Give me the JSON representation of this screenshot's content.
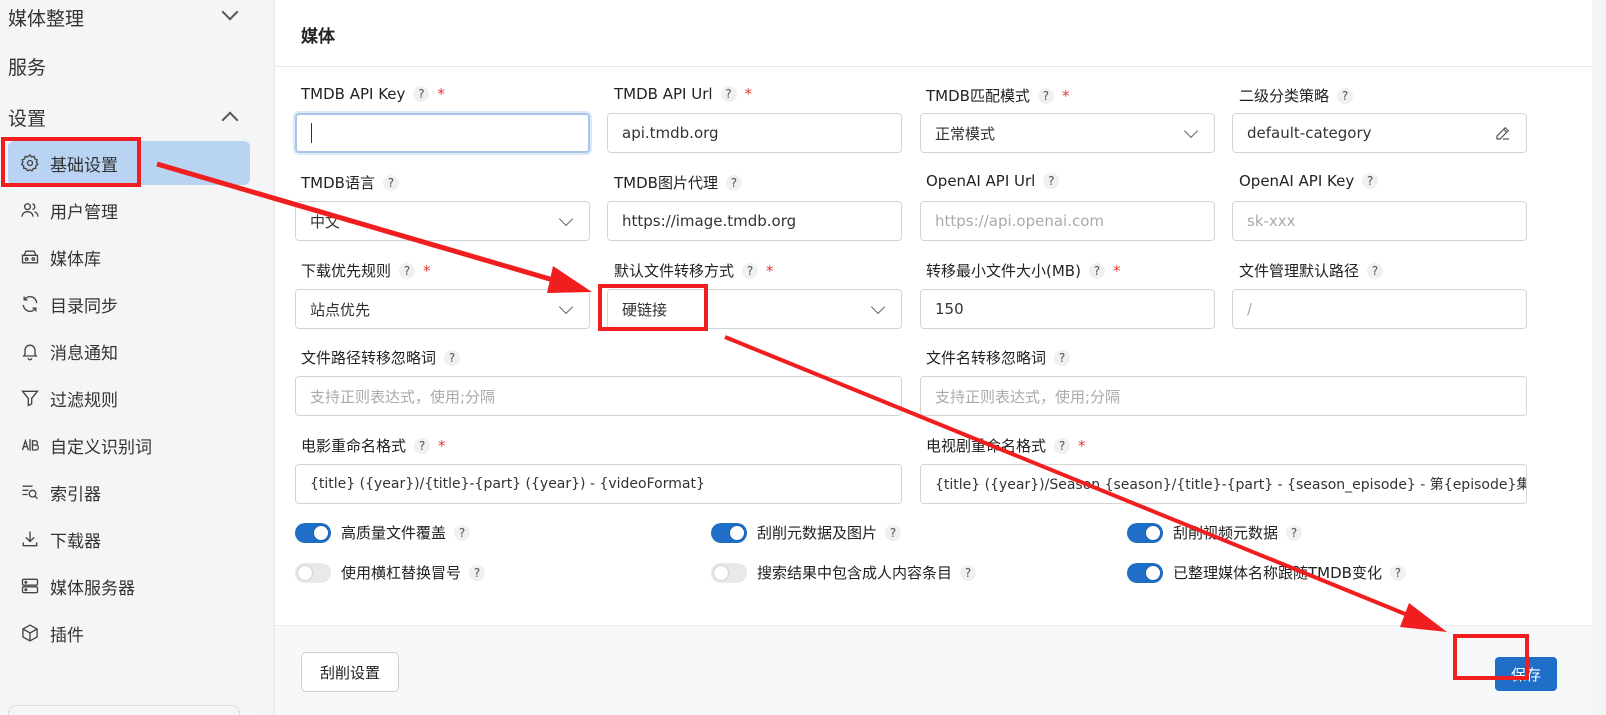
{
  "sidebar": {
    "groups": [
      {
        "label": "媒体整理",
        "expanded": false
      },
      {
        "label": "服务"
      },
      {
        "label": "设置",
        "expanded": true
      }
    ],
    "items": [
      {
        "label": "基础设置",
        "icon": "gear-icon",
        "active": true
      },
      {
        "label": "用户管理",
        "icon": "users-icon"
      },
      {
        "label": "媒体库",
        "icon": "media-library-icon"
      },
      {
        "label": "目录同步",
        "icon": "sync-icon"
      },
      {
        "label": "消息通知",
        "icon": "bell-icon"
      },
      {
        "label": "过滤规则",
        "icon": "filter-icon"
      },
      {
        "label": "自定义识别词",
        "icon": "ab-icon"
      },
      {
        "label": "索引器",
        "icon": "indexer-icon"
      },
      {
        "label": "下载器",
        "icon": "download-icon"
      },
      {
        "label": "媒体服务器",
        "icon": "server-icon"
      },
      {
        "label": "插件",
        "icon": "plugin-icon"
      }
    ]
  },
  "card": {
    "title": "媒体",
    "help_mark": "?",
    "required_mark": "*",
    "fields": {
      "tmdb_api_key": {
        "label": "TMDB API Key",
        "value": ""
      },
      "tmdb_api_url": {
        "label": "TMDB API Url",
        "value": "api.tmdb.org"
      },
      "tmdb_match_mode": {
        "label": "TMDB匹配模式",
        "value": "正常模式"
      },
      "secondary_category": {
        "label": "二级分类策略",
        "value": "default-category"
      },
      "tmdb_language": {
        "label": "TMDB语言",
        "value": "中文"
      },
      "tmdb_image_proxy": {
        "label": "TMDB图片代理",
        "value": "https://image.tmdb.org"
      },
      "openai_api_url": {
        "label": "OpenAI API Url",
        "placeholder": "https://api.openai.com"
      },
      "openai_api_key": {
        "label": "OpenAI API Key",
        "placeholder": "sk-xxx"
      },
      "download_priority": {
        "label": "下载优先规则",
        "value": "站点优先"
      },
      "transfer_mode": {
        "label": "默认文件转移方式",
        "value": "硬链接"
      },
      "min_file_size": {
        "label": "转移最小文件大小(MB)",
        "value": "150"
      },
      "file_manager_path": {
        "label": "文件管理默认路径",
        "placeholder": "/"
      },
      "path_ignore_words": {
        "label": "文件路径转移忽略词",
        "placeholder": "支持正则表达式，使用;分隔"
      },
      "filename_ignore_words": {
        "label": "文件名转移忽略词",
        "placeholder": "支持正则表达式，使用;分隔"
      },
      "movie_rename_format": {
        "label": "电影重命名格式",
        "value": "{title} ({year})/{title}-{part} ({year}) - {videoFormat}"
      },
      "tv_rename_format": {
        "label": "电视剧重命名格式",
        "value": "{title} ({year})/Season {season}/{title}-{part} - {season_episode} - 第{episode}集"
      }
    },
    "switches": [
      {
        "label": "高质量文件覆盖",
        "on": true
      },
      {
        "label": "刮削元数据及图片",
        "on": true
      },
      {
        "label": "刮削视频元数据",
        "on": true
      },
      {
        "label": "使用横杠替换冒号",
        "on": false
      },
      {
        "label": "搜索结果中包含成人内容条目",
        "on": false
      },
      {
        "label": "已整理媒体名称跟随TMDB变化",
        "on": true
      }
    ],
    "footer": {
      "scrape_settings_label": "刮削设置",
      "save_label": "保存"
    }
  },
  "colors": {
    "primary": "#1f6fc9",
    "active_nav": "#b9d3f2",
    "annotation": "#f01e1e",
    "required": "#e53935"
  }
}
